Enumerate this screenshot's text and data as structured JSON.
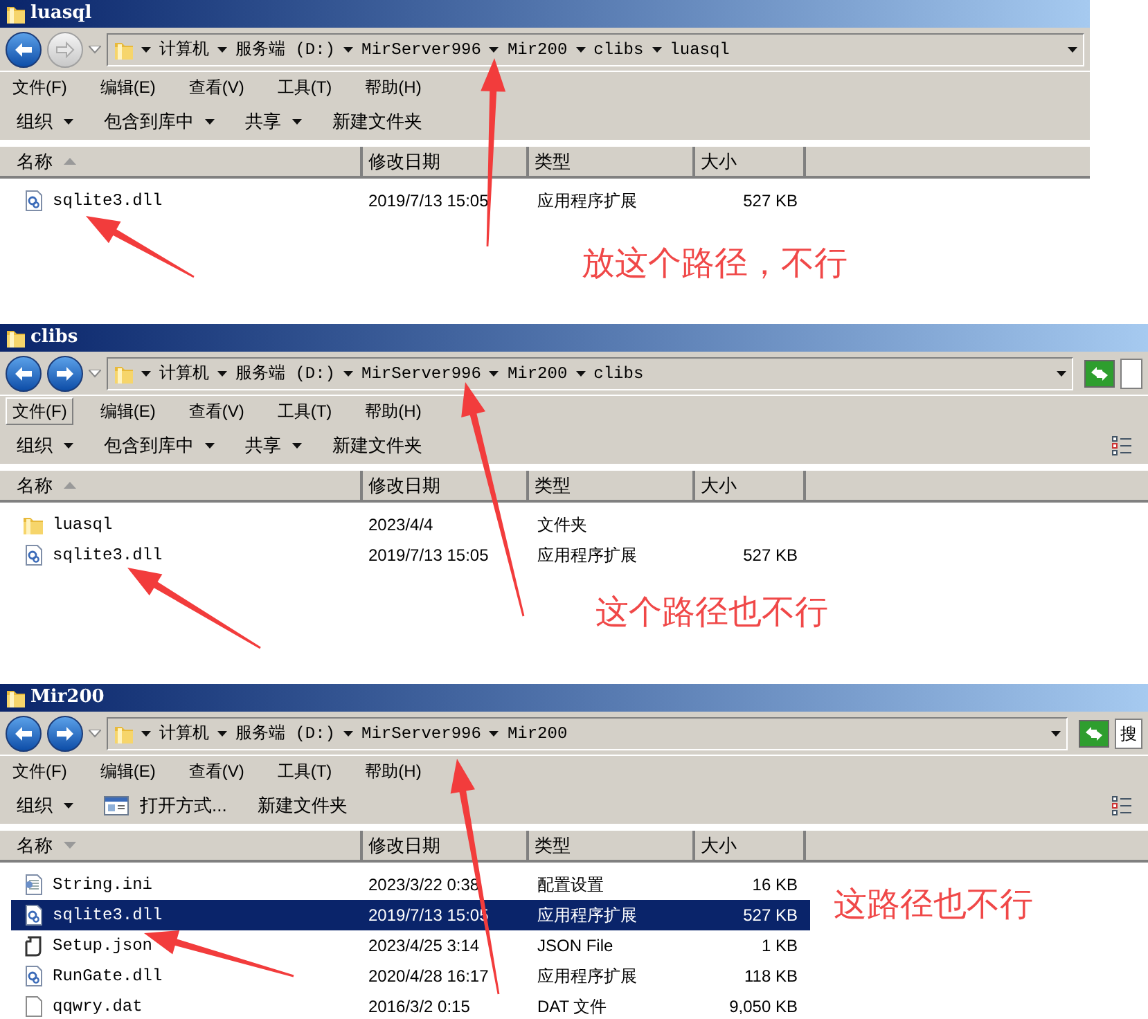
{
  "panels": [
    {
      "title": "luasql",
      "forward_enabled": false,
      "breadcrumb": [
        "计算机",
        "服务端 (D:)",
        "MirServer996",
        "Mir200",
        "clibs",
        "luasql"
      ],
      "menu": [
        {
          "label": "文件(F)",
          "selected": false
        },
        {
          "label": "编辑(E)",
          "selected": false
        },
        {
          "label": "查看(V)",
          "selected": false
        },
        {
          "label": "工具(T)",
          "selected": false
        },
        {
          "label": "帮助(H)",
          "selected": false
        }
      ],
      "toolbar": [
        {
          "label": "组织",
          "kind": "dropdown"
        },
        {
          "label": "包含到库中",
          "kind": "dropdown"
        },
        {
          "label": "共享",
          "kind": "dropdown"
        },
        {
          "label": "新建文件夹",
          "kind": "plain"
        }
      ],
      "columns": [
        {
          "label": "名称",
          "sort_ascending": true
        },
        {
          "label": "修改日期"
        },
        {
          "label": "类型"
        },
        {
          "label": "大小"
        }
      ],
      "rows": [
        {
          "name": "sqlite3.dll",
          "kind": "dll",
          "modified": "2019/7/13 15:05",
          "type": "应用程序扩展",
          "size": "527 KB",
          "selected": false
        }
      ]
    },
    {
      "title": "clibs",
      "forward_enabled": true,
      "breadcrumb": [
        "计算机",
        "服务端 (D:)",
        "MirServer996",
        "Mir200",
        "clibs"
      ],
      "refresh_button": true,
      "view_button": true,
      "menu": [
        {
          "label": "文件(F)",
          "selected": true
        },
        {
          "label": "编辑(E)",
          "selected": false
        },
        {
          "label": "查看(V)",
          "selected": false
        },
        {
          "label": "工具(T)",
          "selected": false
        },
        {
          "label": "帮助(H)",
          "selected": false
        }
      ],
      "toolbar": [
        {
          "label": "组织",
          "kind": "dropdown"
        },
        {
          "label": "包含到库中",
          "kind": "dropdown"
        },
        {
          "label": "共享",
          "kind": "dropdown"
        },
        {
          "label": "新建文件夹",
          "kind": "plain"
        }
      ],
      "columns": [
        {
          "label": "名称",
          "sort_ascending": true
        },
        {
          "label": "修改日期"
        },
        {
          "label": "类型"
        },
        {
          "label": "大小"
        }
      ],
      "rows": [
        {
          "name": "luasql",
          "kind": "folder",
          "modified": "2023/4/4",
          "type": "文件夹",
          "selected": false
        },
        {
          "name": "sqlite3.dll",
          "kind": "dll",
          "modified": "2019/7/13 15:05",
          "type": "应用程序扩展",
          "size": "527 KB",
          "selected": false
        }
      ]
    },
    {
      "title": "Mir200",
      "forward_enabled": true,
      "breadcrumb": [
        "计算机",
        "服务端 (D:)",
        "MirServer996",
        "Mir200"
      ],
      "refresh_button": true,
      "view_button": true,
      "search_placeholder": "搜",
      "menu": [
        {
          "label": "文件(F)",
          "selected": false
        },
        {
          "label": "编辑(E)",
          "selected": false
        },
        {
          "label": "查看(V)",
          "selected": false
        },
        {
          "label": "工具(T)",
          "selected": false
        },
        {
          "label": "帮助(H)",
          "selected": false
        }
      ],
      "toolbar": [
        {
          "label": "组织",
          "kind": "dropdown"
        },
        {
          "label": "打开方式...",
          "kind": "open-with"
        },
        {
          "label": "新建文件夹",
          "kind": "plain"
        }
      ],
      "columns": [
        {
          "label": "名称",
          "sort_ascending": false
        },
        {
          "label": "修改日期"
        },
        {
          "label": "类型"
        },
        {
          "label": "大小"
        }
      ],
      "rows": [
        {
          "name": "String.ini",
          "kind": "ini",
          "modified": "2023/3/22 0:38",
          "type": "配置设置",
          "size": "16 KB",
          "selected": false
        },
        {
          "name": "sqlite3.dll",
          "kind": "dll",
          "modified": "2019/7/13 15:05",
          "type": "应用程序扩展",
          "size": "527 KB",
          "selected": true
        },
        {
          "name": "Setup.json",
          "kind": "json",
          "modified": "2023/4/25 3:14",
          "type": "JSON File",
          "size": "1 KB",
          "selected": false
        },
        {
          "name": "RunGate.dll",
          "kind": "dll",
          "modified": "2020/4/28 16:17",
          "type": "应用程序扩展",
          "size": "118 KB",
          "selected": false
        },
        {
          "name": "qqwry.dat",
          "kind": "dat",
          "modified": "2016/3/2 0:15",
          "type": "DAT 文件",
          "size": "9,050 KB",
          "selected": false
        }
      ]
    }
  ],
  "annotations": [
    {
      "text": "放这个路径，不行"
    },
    {
      "text": "这个路径也不行"
    },
    {
      "text": "这路径也不行"
    }
  ]
}
